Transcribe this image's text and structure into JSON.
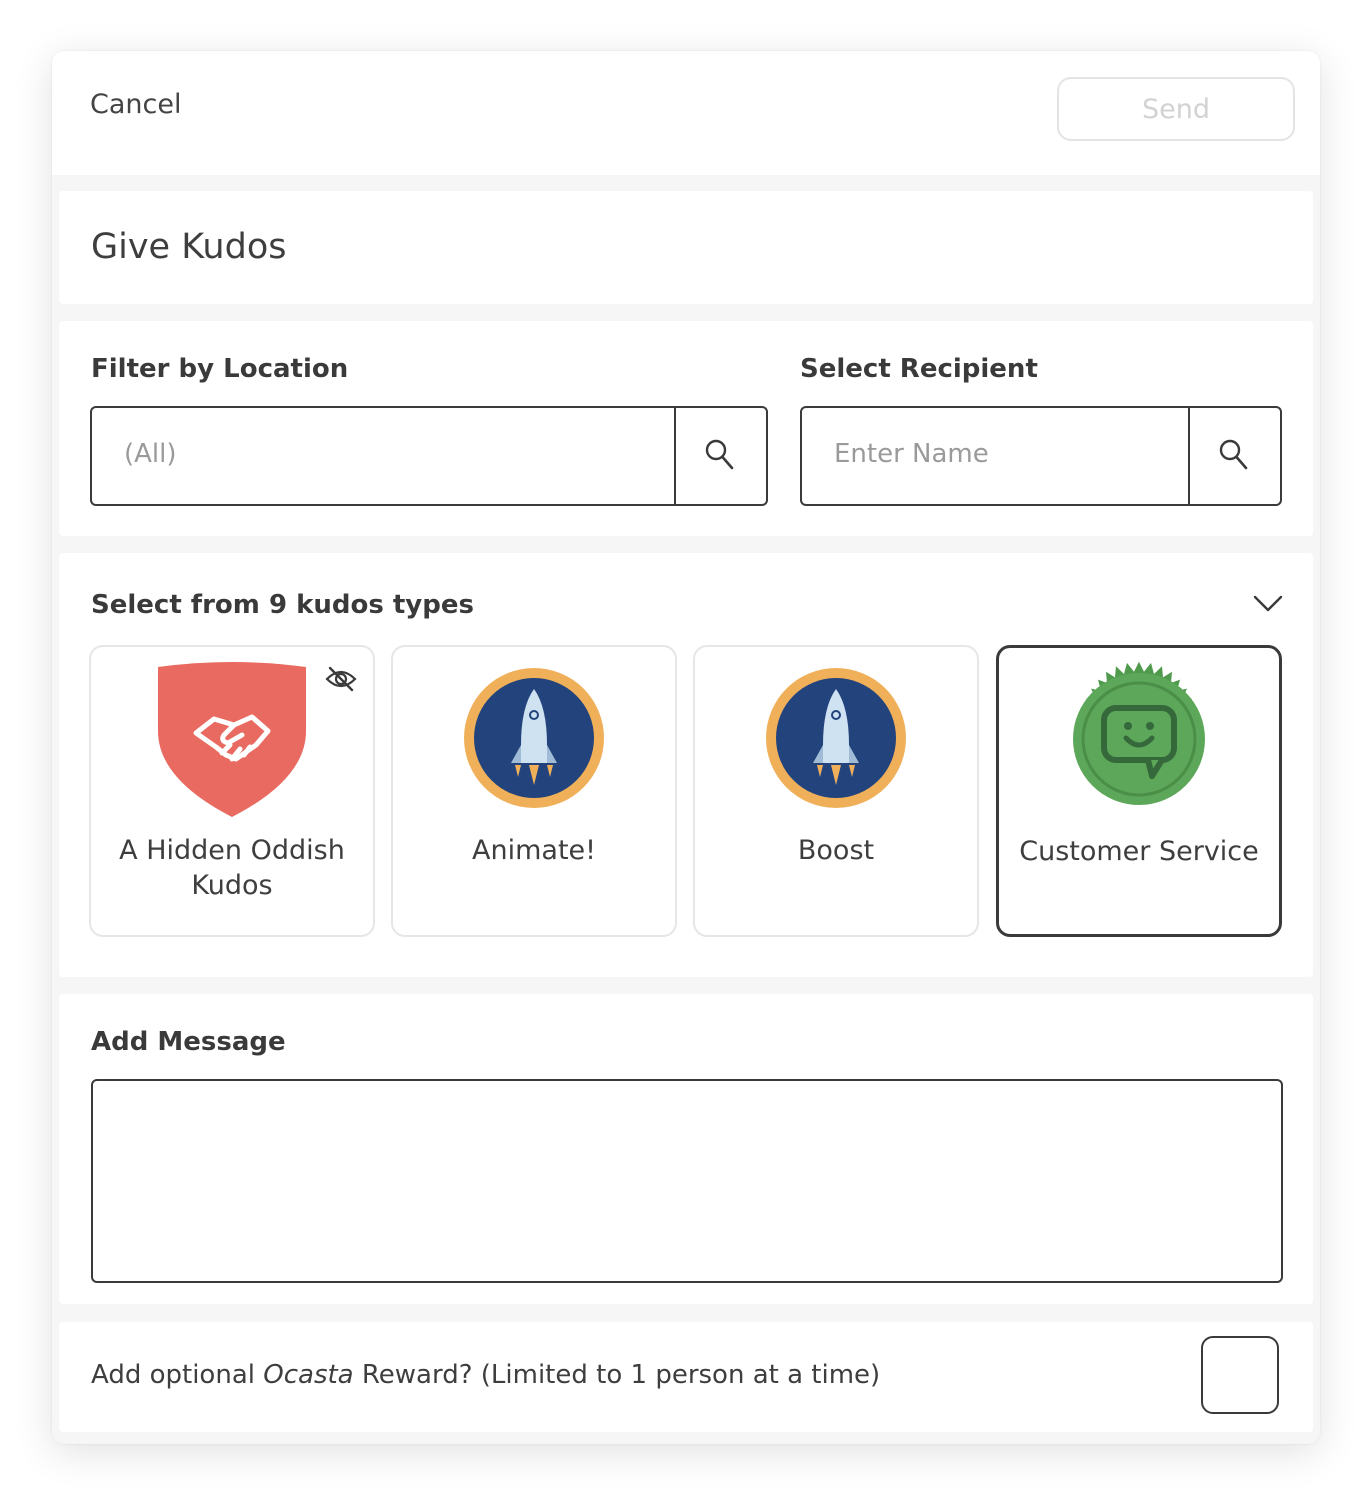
{
  "header": {
    "cancel_label": "Cancel",
    "send_label": "Send"
  },
  "title": "Give Kudos",
  "filters": {
    "location_label": "Filter by Location",
    "location_value": "(All)",
    "recipient_label": "Select Recipient",
    "recipient_placeholder": "Enter Name"
  },
  "kudos": {
    "heading": "Select from 9 kudos types",
    "types": [
      {
        "name_line1": "A Hidden Oddish",
        "name_line2": "Kudos",
        "icon": "handshake-shield-icon",
        "hidden": true,
        "selected": false
      },
      {
        "name_line1": "Animate!",
        "icon": "rocket-badge-icon",
        "selected": false
      },
      {
        "name_line1": "Boost",
        "icon": "rocket-badge-icon",
        "selected": false
      },
      {
        "name_line1": "Customer Service",
        "icon": "chat-smile-seal-icon",
        "selected": true
      }
    ]
  },
  "message": {
    "label": "Add Message",
    "value": ""
  },
  "reward": {
    "text_before": "Add optional ",
    "brand": "Ocasta",
    "text_after": " Reward? (Limited to 1 person at a time)",
    "checked": false
  },
  "colors": {
    "shield_red": "#e96a60",
    "rocket_navy": "#23437c",
    "rocket_ring": "#f0b05a",
    "seal_green": "#5da75a",
    "border_dark": "#3a3a3a"
  }
}
